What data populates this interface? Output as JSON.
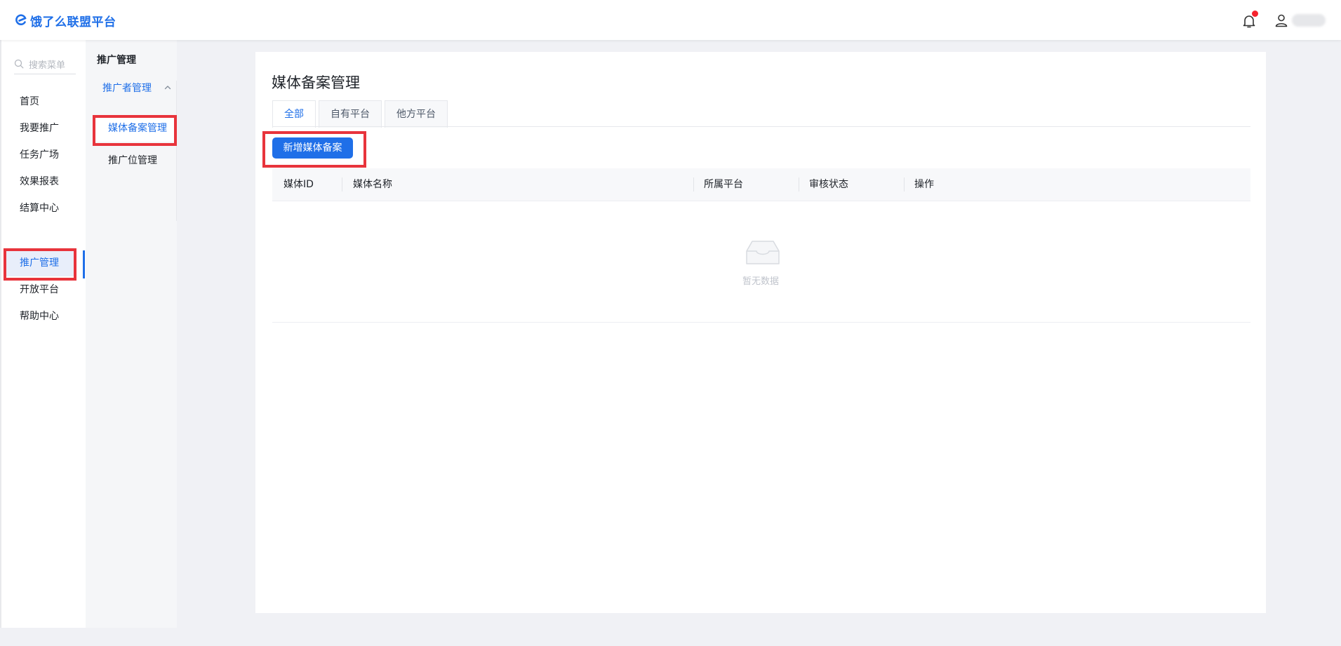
{
  "header": {
    "logo_text": "饿了么联盟平台",
    "brand_color": "#1f6fe8",
    "notification_icon": "bell-icon",
    "has_unread_notification": true,
    "user_icon": "user-icon"
  },
  "sidebar": {
    "search_placeholder": "搜索菜单",
    "items": [
      {
        "label": "首页"
      },
      {
        "label": "我要推广"
      },
      {
        "label": "任务广场"
      },
      {
        "label": "效果报表"
      },
      {
        "label": "结算中心"
      },
      {
        "label": "推广管理",
        "active": true
      },
      {
        "label": "开放平台"
      },
      {
        "label": "帮助中心"
      }
    ]
  },
  "subnav": {
    "title": "推广管理",
    "group_label": "推广者管理",
    "items": [
      {
        "label": "媒体备案管理",
        "active": true
      },
      {
        "label": "推广位管理"
      }
    ]
  },
  "main": {
    "title": "媒体备案管理",
    "tabs": [
      {
        "label": "全部",
        "active": true
      },
      {
        "label": "自有平台"
      },
      {
        "label": "他方平台"
      }
    ],
    "add_button": "新增媒体备案",
    "table": {
      "columns": [
        "媒体ID",
        "媒体名称",
        "所属平台",
        "审核状态",
        "操作"
      ],
      "rows": [],
      "empty_text": "暂无数据"
    }
  }
}
